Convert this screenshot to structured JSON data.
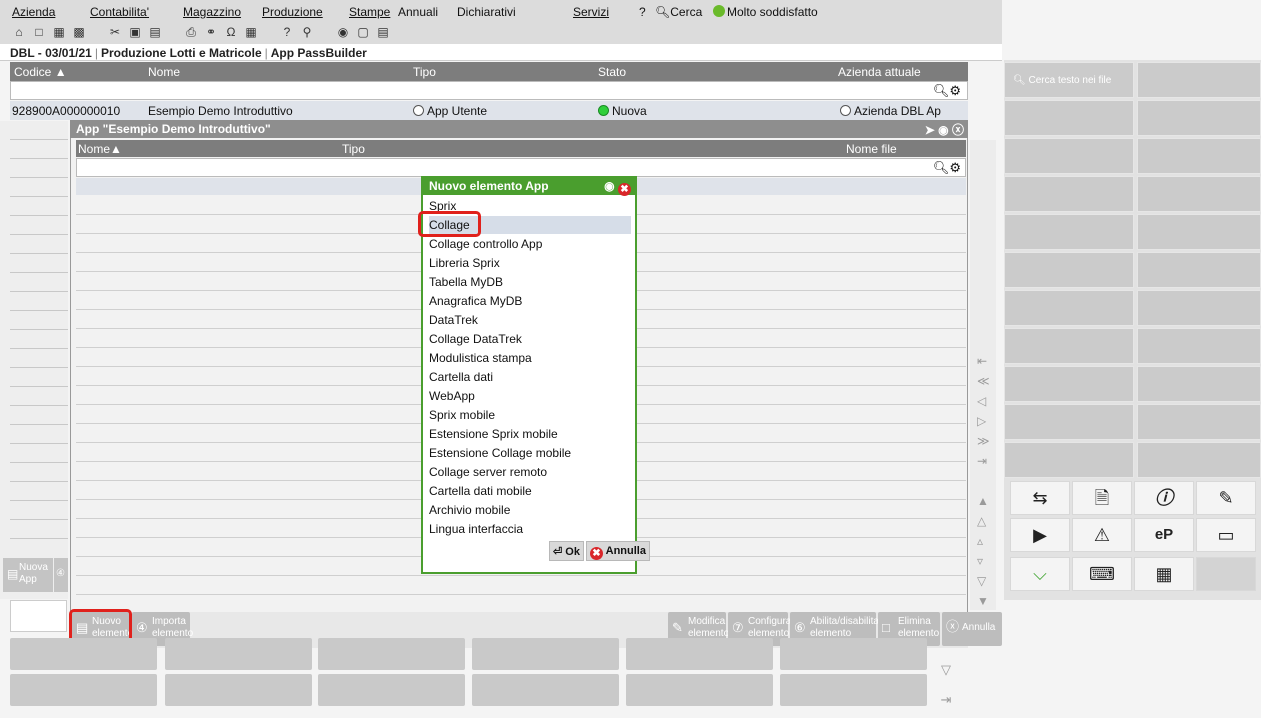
{
  "menu": {
    "items": [
      "Azienda",
      "Contabilita'",
      "Magazzino",
      "Produzione",
      "Stampe",
      "Annuali",
      "Dichiarativi",
      "Servizi"
    ],
    "help": "?",
    "search": "Cerca",
    "status": "Molto soddisfatto"
  },
  "breadcrumb": [
    "DBL - 03/01/21",
    "Produzione Lotti e Matricole",
    "App PassBuilder"
  ],
  "main_table": {
    "columns": [
      "Codice",
      "Nome",
      "Tipo",
      "Stato",
      "Azienda attuale"
    ],
    "row": {
      "codice": "928900A000000010",
      "nome": "Esempio Demo Introduttivo",
      "tipo": "App Utente",
      "stato": "Nuova",
      "azienda": "Azienda DBL Ap"
    }
  },
  "dialog": {
    "title": "App \"Esempio Demo Introduttivo\"",
    "columns": [
      "Nome",
      "Tipo",
      "Nome file"
    ],
    "buttons": {
      "nuovo": [
        "Nuovo",
        "elemento"
      ],
      "importa": [
        "Importa",
        "elemento"
      ],
      "modifica": [
        "Modifica",
        "elemento"
      ],
      "configura": [
        "Configura",
        "elemento"
      ],
      "abilita": [
        "Abilita/disabilita",
        "elemento"
      ],
      "elimina": [
        "Elimina",
        "elemento"
      ],
      "annulla": "Annulla"
    }
  },
  "popup": {
    "title": "Nuovo elemento App",
    "items": [
      "Sprix",
      "Collage",
      "Collage controllo App",
      "Libreria Sprix",
      "Tabella MyDB",
      "Anagrafica MyDB",
      "DataTrek",
      "Collage DataTrek",
      "Modulistica stampa",
      "Cartella dati",
      "WebApp",
      "Sprix mobile",
      "Estensione Sprix mobile",
      "Estensione Collage mobile",
      "Collage server remoto",
      "Cartella dati mobile",
      "Archivio mobile",
      "Lingua interfaccia"
    ],
    "selected": "Collage",
    "ok": "Ok",
    "cancel": "Annulla"
  },
  "left_buttons": {
    "nuova_app": [
      "Nuova",
      "App"
    ]
  },
  "sidebar": {
    "search_files": "Cerca testo nei file",
    "icons": [
      "network-transfer-icon",
      "document-search-icon",
      "info-icon",
      "pen-document-icon",
      "monitor-play-icon",
      "chart-warning-icon",
      "ep-lock-icon",
      "card-icon",
      "basket-icon",
      "keyboard-icon",
      "calculator-icon"
    ]
  }
}
